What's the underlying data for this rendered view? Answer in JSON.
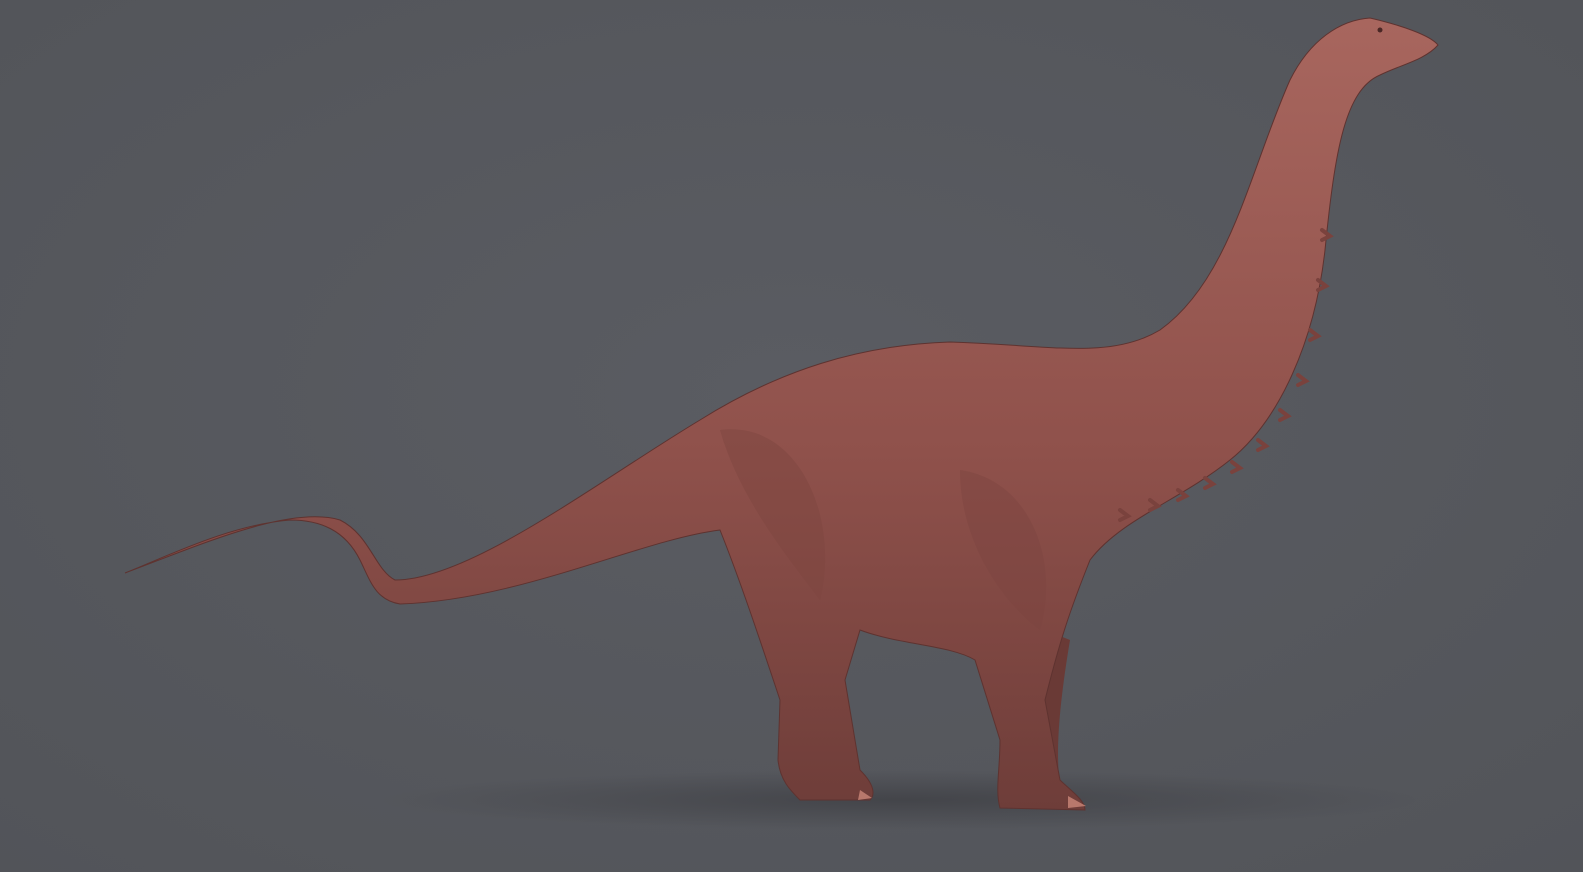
{
  "colors": {
    "background": "#56585e",
    "skin": "#93554f",
    "skin_shadow": "#6e3d39",
    "skin_highlight": "#a8665e",
    "ground_shadow": "#46474c"
  }
}
